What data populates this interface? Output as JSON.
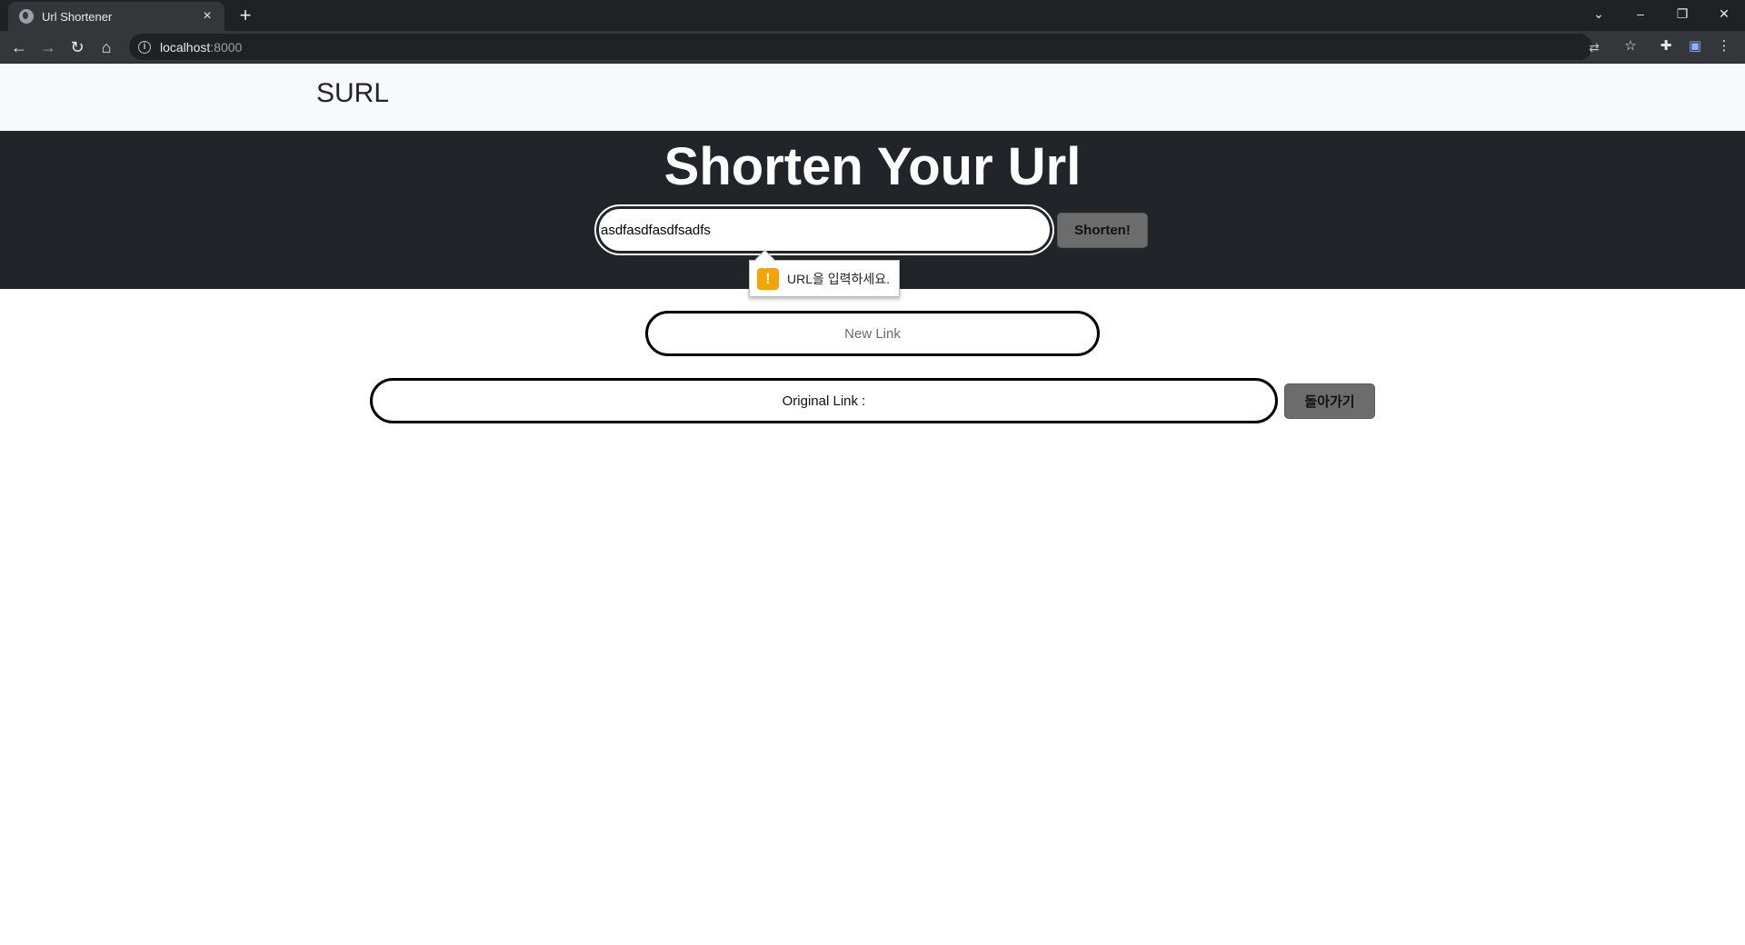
{
  "browser": {
    "tab_title": "Url Shortener",
    "tab_close": "×",
    "new_tab": "+",
    "url_host": "localhost",
    "url_port": ":8000",
    "window_controls": {
      "tab_search": "⌄",
      "minimize": "–",
      "restore": "❐",
      "close": "✕"
    },
    "nav": {
      "back": "←",
      "forward": "→",
      "reload": "↻",
      "home": "⌂"
    }
  },
  "navbar": {
    "brand": "SURL"
  },
  "hero": {
    "title": "Shorten Your Url",
    "url_input_value": "asdfasdfasdfsadfs",
    "shorten_button": "Shorten!"
  },
  "validation_tooltip": {
    "icon": "!",
    "message": "URL을 입력하세요."
  },
  "results": {
    "new_link_placeholder": "New Link",
    "original_link_label": "Original Link :",
    "back_button": "돌아가기"
  },
  "colors": {
    "hero_bg": "#212529",
    "navbar_bg": "#f8f9fa",
    "button_bg": "#6c6c6c",
    "warning": "#f4a300"
  }
}
